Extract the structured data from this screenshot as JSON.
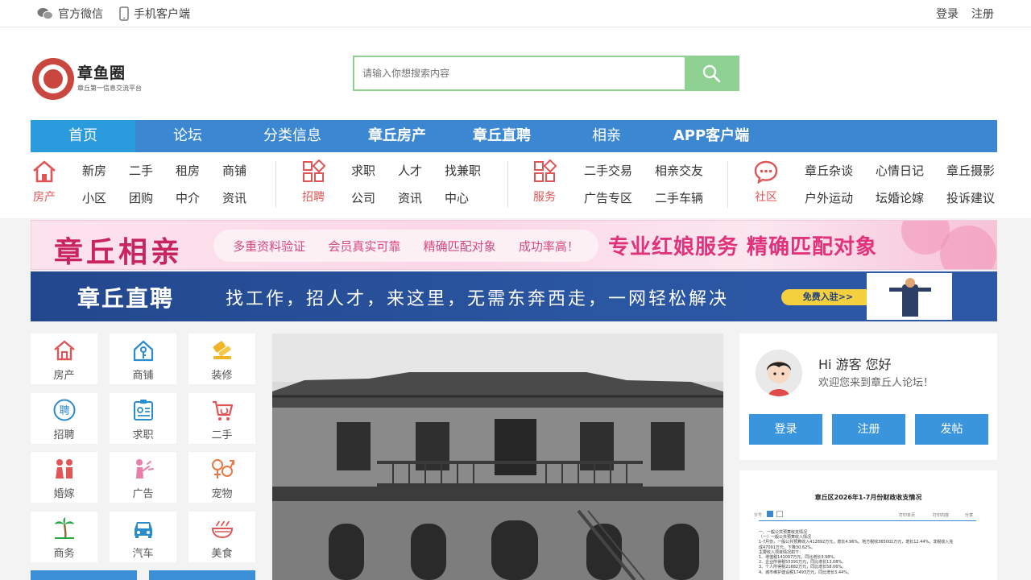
{
  "topbar": {
    "wechat": "官方微信",
    "mobile": "手机客户端",
    "login": "登录",
    "register": "注册"
  },
  "logo": {
    "name": "章鱼圈",
    "slogan": "章丘第一信息交流平台"
  },
  "search": {
    "placeholder": "请输入你想搜索内容"
  },
  "nav": [
    {
      "label": "首页"
    },
    {
      "label": "论坛"
    },
    {
      "label": "分类信息"
    },
    {
      "label": "章丘房产"
    },
    {
      "label": "章丘直聘"
    },
    {
      "label": "相亲"
    },
    {
      "label": "APP客户端"
    }
  ],
  "subcat": [
    {
      "label": "房产",
      "links": [
        "新房",
        "小区",
        "二手",
        "团购",
        "租房",
        "中介",
        "商铺",
        "资讯"
      ]
    },
    {
      "label": "招聘",
      "links": [
        "求职",
        "公司",
        "人才",
        "资讯",
        "找兼职",
        "中心"
      ]
    },
    {
      "label": "服务",
      "links": [
        "二手交易",
        "广告专区",
        "相亲交友",
        "二手车辆"
      ]
    },
    {
      "label": "社区",
      "links": [
        "章丘杂谈",
        "户外运动",
        "心情日记",
        "坛婚论嫁",
        "章丘摄影",
        "投诉建议"
      ]
    }
  ],
  "banner1": {
    "title": "章丘相亲",
    "points": [
      "多重资料验证",
      "会员真实可靠",
      "精确匹配对象",
      "成功率高！"
    ],
    "slogan": "专业红娘服务 精确匹配对象"
  },
  "banner2": {
    "title": "章丘直聘",
    "text": "找工作，招人才，来这里，无需东奔西走，一网轻松解决",
    "chip": "免费入驻>>"
  },
  "cats": [
    {
      "label": "房产",
      "icon": "house-icon"
    },
    {
      "label": "商铺",
      "icon": "shop-icon"
    },
    {
      "label": "装修",
      "icon": "paint-roller-icon"
    },
    {
      "label": "招聘",
      "icon": "hire-icon"
    },
    {
      "label": "求职",
      "icon": "id-card-icon"
    },
    {
      "label": "二手",
      "icon": "cart-icon"
    },
    {
      "label": "婚嫁",
      "icon": "couple-icon"
    },
    {
      "label": "广告",
      "icon": "megaphone-icon"
    },
    {
      "label": "宠物",
      "icon": "gender-icon"
    },
    {
      "label": "商务",
      "icon": "palm-tree-icon"
    },
    {
      "label": "汽车",
      "icon": "car-icon"
    },
    {
      "label": "美食",
      "icon": "noodle-bowl-icon"
    }
  ],
  "user": {
    "greeting": "Hi 游客 您好",
    "welcome": "欢迎您来到章丘人论坛！",
    "login": "登录",
    "register": "注册",
    "post": "发帖"
  },
  "doc": {
    "title": "章丘区2026年1-7月份财政收支情况",
    "tool_print": "打印本页",
    "tool_close": "打印内容",
    "tool_share": "分享",
    "line1": "一、一般公共预算收支情况",
    "line2": "（一）一般公共预算收入情况",
    "line3": "1-7月份，一般公共预算收入412892万元，增长4.96%。地方税收365001万元，增长12.44%，非税收入完",
    "line4": "成47091万元，下降30.62%。",
    "line5": "主要收入项目情况如下：",
    "line6": "1、增值税141097万元，同比增长3.98%。",
    "line7": "2、企业所得税55391万元，同比增长13.08%。",
    "line8": "3、个人所得税21682万元，同比增长58.06%。",
    "line9": "4、城市维护建设税17493万元，同比增长3.44%。"
  },
  "colors": {
    "nav": "#3b87d2",
    "accent_red": "#e05555",
    "search_green": "#8ed193",
    "button_blue": "#3b95dc"
  }
}
